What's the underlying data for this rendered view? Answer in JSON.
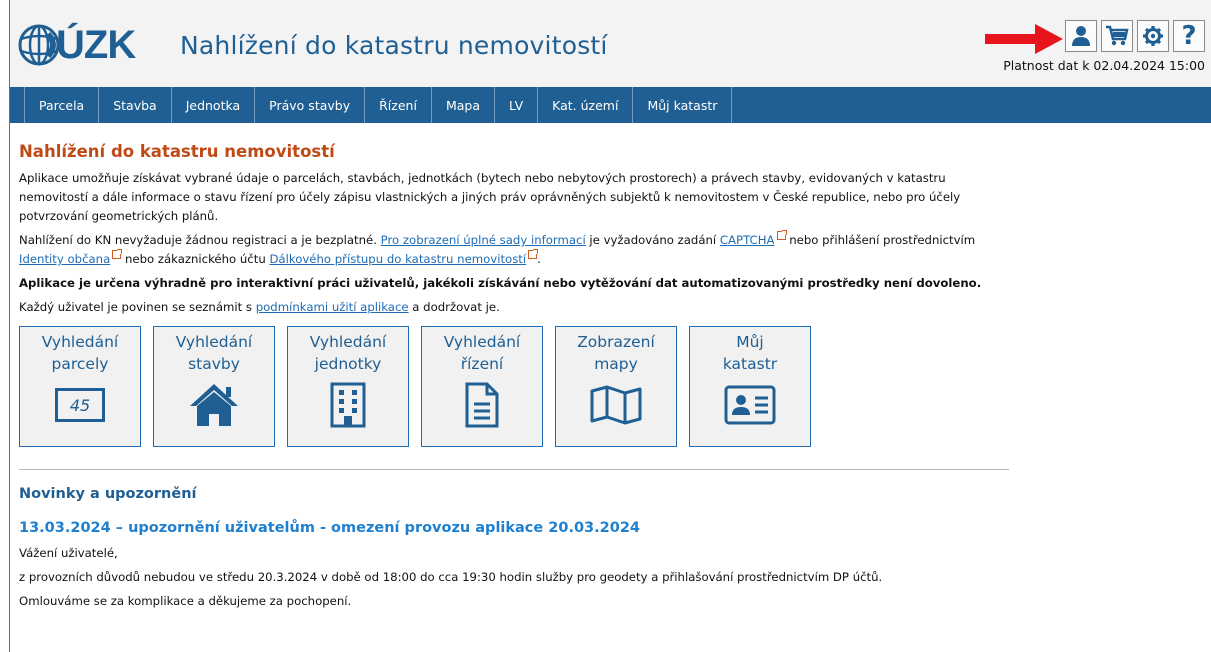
{
  "header": {
    "logo_text": "ÚZK",
    "app_title": "Nahlížení do katastru nemovitostí",
    "validity": "Platnost dat k 02.04.2024 15:00",
    "icons": [
      "user-icon",
      "cart-icon",
      "gear-icon",
      "help-icon"
    ],
    "help_glyph": "?",
    "accent_color": "#1f5f93",
    "arrow_color": "#e8141b"
  },
  "nav": {
    "items": [
      "Parcela",
      "Stavba",
      "Jednotka",
      "Právo stavby",
      "Řízení",
      "Mapa",
      "LV",
      "Kat. území",
      "Můj katastr"
    ]
  },
  "main": {
    "title": "Nahlížení do katastru nemovitostí",
    "intro": "Aplikace umožňuje získávat vybrané údaje o parcelách, stavbách, jednotkách (bytech nebo nebytových prostorech) a právech stavby, evidovaných v katastru nemovitostí a dále informace o stavu řízení pro účely zápisu vlastnických a jiných práv oprávněných subjektů k nemovitostem v České republice, nebo pro účely potvrzování geometrických plánů.",
    "access": {
      "t1": "Nahlížení do KN nevyžaduje žádnou registraci a je bezplatné. ",
      "link1": "Pro zobrazení úplné sady informací",
      "t2": " je vyžadováno zadání ",
      "link2": "CAPTCHA",
      "t3": " nebo přihlášení prostřednictvím ",
      "link3": "Identity občana",
      "t4": " nebo zákaznického účtu ",
      "link4": "Dálkového přístupu do katastru nemovitostí",
      "t5": "."
    },
    "warning": "Aplikace je určena výhradně pro interaktivní práci uživatelů, jakékoli získávání nebo vytěžování dat automatizovanými prostředky není dovoleno.",
    "terms": {
      "t1": "Každý uživatel je povinen se seznámit s ",
      "link": "podmínkami užití aplikace",
      "t2": " a dodržovat je."
    },
    "tiles": [
      {
        "line1": "Vyhledání",
        "line2": "parcely",
        "icon": "parcel-number-icon",
        "badge": "45"
      },
      {
        "line1": "Vyhledání",
        "line2": "stavby",
        "icon": "house-icon"
      },
      {
        "line1": "Vyhledání",
        "line2": "jednotky",
        "icon": "building-icon"
      },
      {
        "line1": "Vyhledání",
        "line2": "řízení",
        "icon": "document-icon"
      },
      {
        "line1": "Zobrazení",
        "line2": "mapy",
        "icon": "map-icon"
      },
      {
        "line1": "Můj",
        "line2": "katastr",
        "icon": "id-card-icon"
      }
    ]
  },
  "news": {
    "heading": "Novinky a upozornění",
    "title": "13.03.2024 – upozornění uživatelům - omezení provozu aplikace 20.03.2024",
    "lines": [
      "Vážení uživatelé,",
      "z provozních důvodů nebudou ve středu 20.3.2024 v době od 18:00 do cca 19:30 hodin služby pro geodety a přihlašování prostřednictvím DP účtů.",
      "Omlouváme se za komplikace a děkujeme za pochopení."
    ]
  }
}
